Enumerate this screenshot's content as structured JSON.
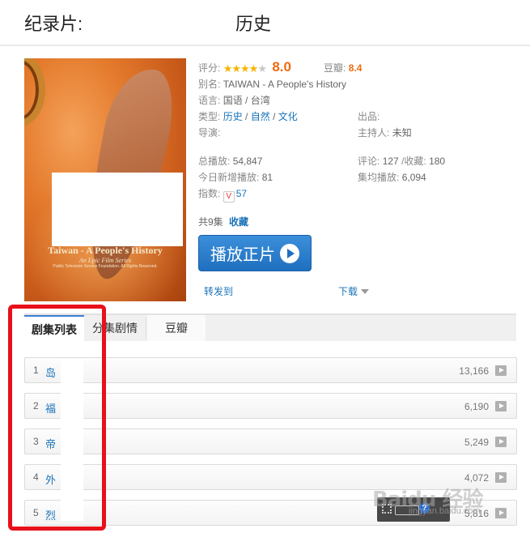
{
  "header": {
    "category": "纪录片:",
    "title": "历史"
  },
  "poster": {
    "title": "Taiwan - A People's History",
    "subtitle": "An Epic Film Series",
    "credit": "Public Television Service Foundation. All Rights Reserved."
  },
  "info": {
    "rating_label": "评分:",
    "rating_stars": 4,
    "rating_max": 5,
    "rating_value": "8.0",
    "douban_label": "豆瓣:",
    "douban_value": "8.4",
    "alias_label": "别名:",
    "alias_value": "TAIWAN - A People's History",
    "language_label": "语言:",
    "language_value": "国语 / 台湾",
    "genre_label": "类型:",
    "genres": [
      "历史",
      "自然",
      "文化"
    ],
    "genre_sep": " / ",
    "producer_label": "出品:",
    "director_label": "导演:",
    "host_label": "主持人:",
    "host_value": "未知",
    "total_plays_label": "总播放:",
    "total_plays": "54,847",
    "comments_label": "评论:",
    "comments": "127",
    "favorites_label": "/收藏:",
    "favorites": "180",
    "today_label": "今日新增播放:",
    "today": "81",
    "avg_label": "集均播放:",
    "avg": "6,094",
    "index_label": "指数:",
    "index_icon": "V",
    "index_value": "57",
    "episodes_prefix": "共9集",
    "favorite_link": "收藏"
  },
  "actions": {
    "play": "播放正片",
    "share": "转发到",
    "download": "下载"
  },
  "tabs": [
    "剧集列表",
    "分集剧情",
    "豆瓣"
  ],
  "episodes": [
    {
      "num": "1",
      "title": "岛",
      "count": "13,166"
    },
    {
      "num": "2",
      "title": "福",
      "count": "6,190"
    },
    {
      "num": "3",
      "title": "帝",
      "count": "5,249"
    },
    {
      "num": "4",
      "title": "外",
      "count": "4,072"
    },
    {
      "num": "5",
      "title": "烈",
      "count": "5,816"
    }
  ],
  "watermark": {
    "brand": "Baidu 经验",
    "site": "jingyan.baidu.com",
    "help": "?"
  },
  "colors": {
    "link": "#1a73b9",
    "accent_orange": "#f06a10",
    "highlight_red": "#e8101a",
    "button_blue": "#1f6fbf"
  }
}
